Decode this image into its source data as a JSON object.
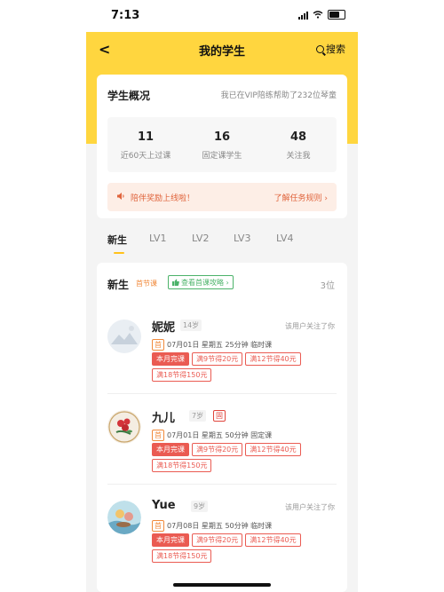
{
  "status": {
    "time": "7:13"
  },
  "nav": {
    "title": "我的学生",
    "search_label": "搜索"
  },
  "overview": {
    "title": "学生概况",
    "subtitle": "我已在VIP陪练帮助了232位琴童",
    "stats": [
      {
        "value": "11",
        "label": "近60天上过课"
      },
      {
        "value": "16",
        "label": "固定课学生"
      },
      {
        "value": "48",
        "label": "关注我"
      }
    ],
    "banner": {
      "text": "陪伴奖励上线啦！",
      "link": "了解任务规则 ›"
    }
  },
  "tabs": [
    "新生",
    "LV1",
    "LV2",
    "LV3",
    "LV4"
  ],
  "list": {
    "title": "新生",
    "first_tag": "首节课",
    "guide_label": "查看首课攻略 ›",
    "count": "3位"
  },
  "students": [
    {
      "name": "妮妮",
      "age": "14岁",
      "gu": "",
      "follow": "该用户关注了你",
      "first": "首",
      "info": "07月01日 星期五 25分钟 临时课",
      "badges": [
        "本月完课",
        "满9节得20元",
        "满12节得40元",
        "满18节得150元"
      ]
    },
    {
      "name": "九儿",
      "age": "7岁",
      "gu": "固",
      "follow": "",
      "first": "首",
      "info": "07月01日 星期五 50分钟 固定课",
      "badges": [
        "本月完课",
        "满9节得20元",
        "满12节得40元",
        "满18节得150元"
      ]
    },
    {
      "name": "Yue",
      "age": "9岁",
      "gu": "",
      "follow": "该用户关注了你",
      "first": "首",
      "info": "07月08日 星期五 50分钟 临时课",
      "badges": [
        "本月完课",
        "满9节得20元",
        "满12节得40元",
        "满18节得150元"
      ]
    }
  ],
  "colors": {
    "brand_yellow": "#ffd63f",
    "accent_orange": "#e0643c",
    "badge_red": "#ea5b52",
    "guide_green": "#4cb36a"
  }
}
